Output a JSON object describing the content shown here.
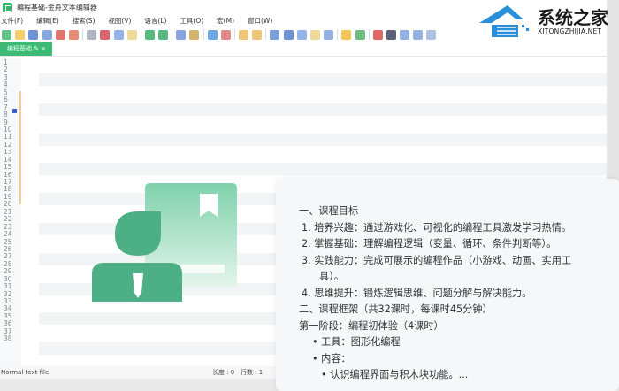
{
  "window": {
    "title": "编程基础-金舟文本编辑器"
  },
  "menu": [
    "文件(F)",
    "编辑(E)",
    "搜索(S)",
    "视图(V)",
    "语言(L)",
    "工具(O)",
    "宏(M)",
    "窗口(W)"
  ],
  "toolbar": [
    {
      "icon": "new-file-icon",
      "color": "#3bb36a"
    },
    {
      "icon": "open-file-icon",
      "color": "#f2c04a"
    },
    {
      "icon": "save-icon",
      "color": "#4a78c9"
    },
    {
      "icon": "save-all-icon",
      "color": "#6a94d6"
    },
    {
      "icon": "close-icon",
      "color": "#d9534f"
    },
    {
      "icon": "close-all-icon",
      "color": "#e07050"
    },
    {
      "icon": "print-icon",
      "color": "#9aa3b0"
    },
    {
      "icon": "cut-icon",
      "color": "#d0404a"
    },
    {
      "icon": "copy-icon",
      "color": "#7aa0e0"
    },
    {
      "icon": "paste-icon",
      "color": "#e8cf80"
    },
    {
      "icon": "undo-icon",
      "color": "#2aa860"
    },
    {
      "icon": "redo-icon",
      "color": "#2aa860"
    },
    {
      "icon": "find-icon",
      "color": "#6b8fd6"
    },
    {
      "icon": "replace-icon",
      "color": "#c9a050"
    },
    {
      "icon": "zoom-in-icon",
      "color": "#4a8fd9"
    },
    {
      "icon": "zoom-out-icon",
      "color": "#d96a6a"
    },
    {
      "icon": "sync-vertical-icon",
      "color": "#e8b858"
    },
    {
      "icon": "sync-horizontal-icon",
      "color": "#e8b858"
    },
    {
      "icon": "word-wrap-icon",
      "color": "#5a86d0"
    },
    {
      "icon": "show-all-chars-icon",
      "color": "#4a78c9"
    },
    {
      "icon": "indent-guide-icon",
      "color": "#7aa0e0"
    },
    {
      "icon": "doc-map-icon",
      "color": "#e8cf80"
    },
    {
      "icon": "function-list-icon",
      "color": "#7a9ed9"
    },
    {
      "icon": "folder-icon",
      "color": "#f0b830"
    },
    {
      "icon": "monitor-icon",
      "color": "#4caa60"
    },
    {
      "icon": "record-macro-icon",
      "color": "#d94040"
    },
    {
      "icon": "stop-macro-icon",
      "color": "#333a55"
    },
    {
      "icon": "play-macro-icon",
      "color": "#7a9ed9"
    },
    {
      "icon": "run-macro-multiple-icon",
      "color": "#7a9ed9"
    },
    {
      "icon": "save-macro-icon",
      "color": "#9ab0d9"
    }
  ],
  "tab": {
    "label": "编程基础 ✎ ×"
  },
  "line_numbers": [
    "1",
    "2",
    "3",
    "4",
    "5",
    "6",
    "7",
    "8",
    "9",
    "10",
    "11",
    "12",
    "13",
    "14",
    "15",
    "16",
    "17",
    "18",
    "19",
    "20",
    "21",
    "22",
    "23",
    "24",
    "25",
    "26",
    "27",
    "28",
    "29",
    "30",
    "31",
    "32",
    "33",
    "34",
    "35",
    "36",
    "37",
    "38"
  ],
  "status": {
    "file_type": "Normal text file",
    "length": "长度 : 0",
    "lines": "行数 : 1"
  },
  "watermark": {
    "name": "系统之家",
    "url": "XITONGZHIJIA.NET"
  },
  "card": {
    "lines": [
      {
        "text": "一、课程目标",
        "level": 0
      },
      {
        "text": "1. 培养兴趣：通过游戏化、可视化的编程工具激发学习热情。",
        "level": 1
      },
      {
        "text": "2. 掌握基础：理解编程逻辑（变量、循环、条件判断等）。",
        "level": 1
      },
      {
        "text": "3. 实践能力：完成可展示的编程作品（小游戏、动画、实用工",
        "level": 1
      },
      {
        "text": "具）。",
        "level": 3
      },
      {
        "text": "4. 思维提升：锻炼逻辑思维、问题分解与解决能力。",
        "level": 1
      },
      {
        "text": "二、课程框架（共32课时，每课时45分钟）",
        "level": 0
      },
      {
        "text": "第一阶段：编程初体验（4课时）",
        "level": -1
      },
      {
        "text": "• 工具：图形化编程",
        "level": 2
      },
      {
        "text": "• 内容：",
        "level": 2
      },
      {
        "text": "• 认识编程界面与积木块功能。...",
        "level": 4
      }
    ]
  },
  "colors": {
    "accent": "#3cba76",
    "illustration": "#4caf85"
  }
}
